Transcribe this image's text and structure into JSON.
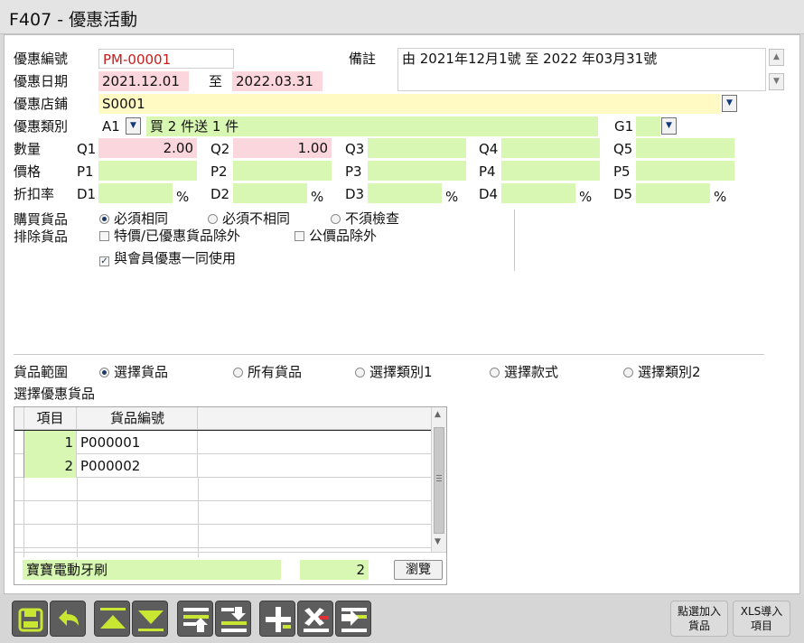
{
  "window": {
    "title": "F407 - 優惠活動"
  },
  "form": {
    "promo_no_label": "優惠編號",
    "promo_no": "PM-00001",
    "remark_label": "備註",
    "remark": "由 2021年12月1號 至 2022 年03月31號",
    "date_label": "優惠日期",
    "date_from": "2021.12.01",
    "to_label": "至",
    "date_to": "2022.03.31",
    "store_label": "優惠店鋪",
    "store": "S0001",
    "type_label": "優惠類別",
    "type_code": "A1",
    "type_desc": "買 2 件送 1 件",
    "g1_label": "G1",
    "qty_label": "數量",
    "price_label": "價格",
    "disc_label": "折扣率",
    "q_labels": [
      "Q1",
      "Q2",
      "Q3",
      "Q4",
      "Q5"
    ],
    "q_values": [
      "2.00",
      "1.00",
      "",
      "",
      ""
    ],
    "p_labels": [
      "P1",
      "P2",
      "P3",
      "P4",
      "P5"
    ],
    "d_labels": [
      "D1",
      "D2",
      "D3",
      "D4",
      "D5"
    ],
    "pct": "%"
  },
  "options": {
    "buy_label": "購買貨品",
    "buy_opt1": "必須相同",
    "buy_opt2": "必須不相同",
    "buy_opt3": "不須檢查",
    "exclude_label": "排除貨品",
    "exclude_opt1": "特價/已優惠貨品除外",
    "exclude_opt2": "公價品除外",
    "member_opt": "與會員優惠一同使用",
    "check_mark": "✓"
  },
  "range": {
    "label": "貨品範圍",
    "opt1": "選擇貨品",
    "opt2": "所有貨品",
    "opt3": "選擇類別1",
    "opt4": "選擇款式",
    "opt5": "選擇類別2",
    "list_label": "選擇優惠貨品"
  },
  "grid": {
    "headers": {
      "item": "項目",
      "code": "貨品編號"
    },
    "rows": [
      {
        "item": "1",
        "code": "P000001"
      },
      {
        "item": "2",
        "code": "P000002"
      }
    ],
    "footer_name": "寶寶電動牙刷",
    "footer_count": "2",
    "browse_label": "瀏覽"
  },
  "toolbar": {
    "import_select_l1": "點選加入",
    "import_select_l2": "貨品",
    "import_xls_l1": "XLS導入",
    "import_xls_l2": "項目"
  },
  "colors": {
    "pink": "#fbd6dc",
    "green": "#d8f7b2",
    "yellow": "#fff9c4",
    "red_text": "#c81c1c",
    "toolbar_button": "#5d5d5d",
    "icon_accent": "#c8e632"
  }
}
